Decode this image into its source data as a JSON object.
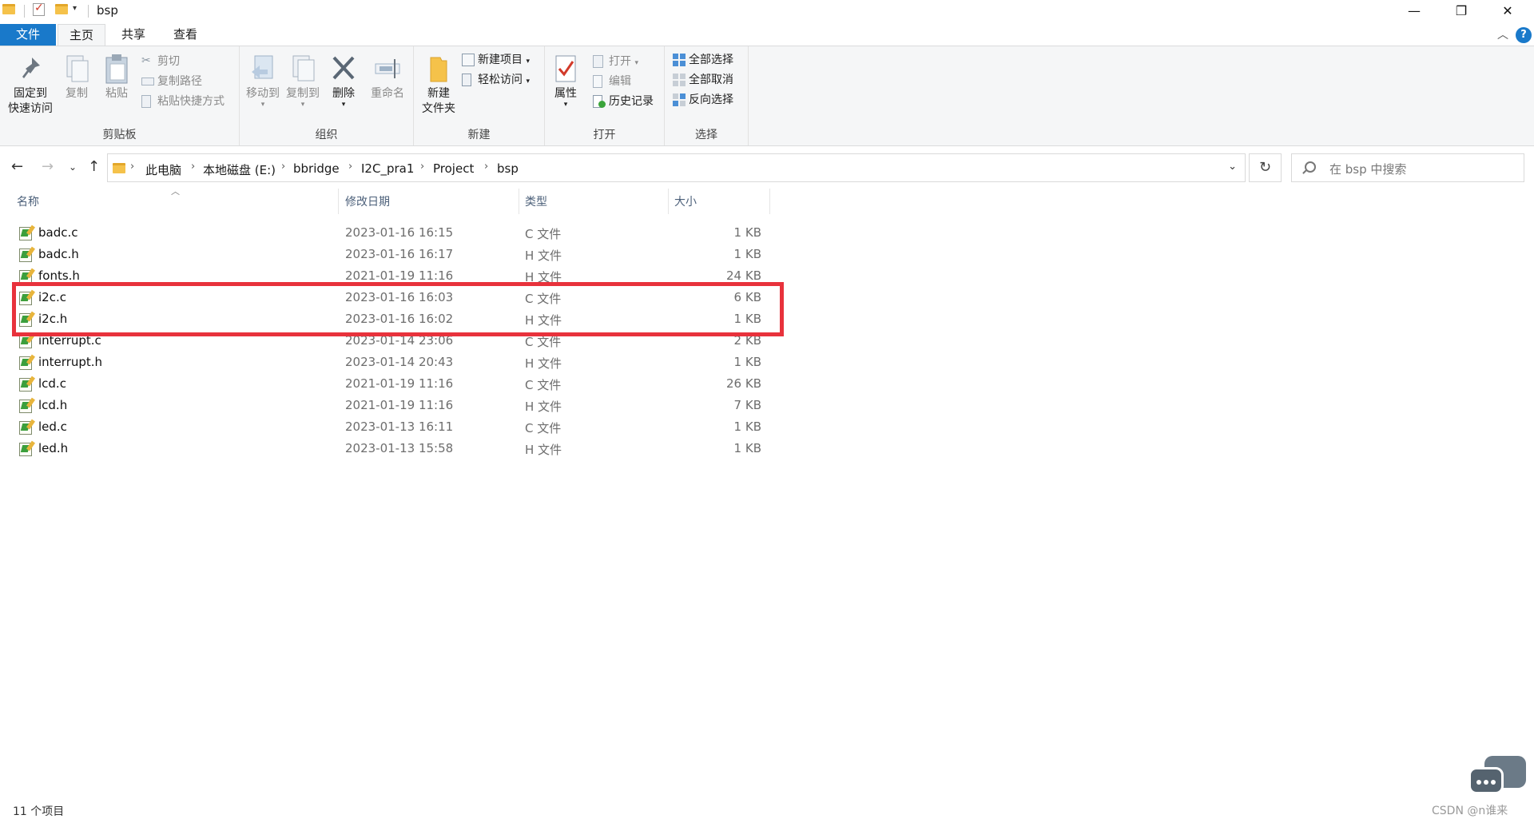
{
  "window": {
    "title": "bsp",
    "quick_access_dropdown": "▾",
    "minimize": "—",
    "maximize": "❐",
    "close": "✕"
  },
  "tabs": [
    {
      "label": "文件"
    },
    {
      "label": "主页"
    },
    {
      "label": "共享"
    },
    {
      "label": "查看"
    }
  ],
  "ribbon": {
    "clipboard": {
      "label": "剪贴板",
      "pin_line1": "固定到",
      "pin_line2": "快速访问",
      "copy": "复制",
      "paste": "粘贴",
      "cut": "剪切",
      "copy_path": "复制路径",
      "paste_shortcut": "粘贴快捷方式"
    },
    "organize": {
      "label": "组织",
      "move_to": "移动到",
      "copy_to": "复制到",
      "delete": "删除",
      "rename": "重命名"
    },
    "new": {
      "label": "新建",
      "new_folder_line1": "新建",
      "new_folder_line2": "文件夹",
      "new_item": "新建项目",
      "easy_access": "轻松访问"
    },
    "open": {
      "label": "打开",
      "properties": "属性",
      "open": "打开",
      "edit": "编辑",
      "history": "历史记录"
    },
    "select": {
      "label": "选择",
      "select_all": "全部选择",
      "select_none": "全部取消",
      "invert": "反向选择"
    }
  },
  "breadcrumb": [
    "此电脑",
    "本地磁盘 (E:)",
    "bbridge",
    "I2C_pra1",
    "Project",
    "bsp"
  ],
  "search": {
    "placeholder": "在 bsp 中搜索"
  },
  "columns": {
    "name": "名称",
    "date": "修改日期",
    "type": "类型",
    "size": "大小"
  },
  "files": [
    {
      "name": "badc.c",
      "date": "2023-01-16 16:15",
      "type": "C 文件",
      "size": "1 KB"
    },
    {
      "name": "badc.h",
      "date": "2023-01-16 16:17",
      "type": "H 文件",
      "size": "1 KB"
    },
    {
      "name": "fonts.h",
      "date": "2021-01-19 11:16",
      "type": "H 文件",
      "size": "24 KB"
    },
    {
      "name": "i2c.c",
      "date": "2023-01-16 16:03",
      "type": "C 文件",
      "size": "6 KB"
    },
    {
      "name": "i2c.h",
      "date": "2023-01-16 16:02",
      "type": "H 文件",
      "size": "1 KB"
    },
    {
      "name": "interrupt.c",
      "date": "2023-01-14 23:06",
      "type": "C 文件",
      "size": "2 KB"
    },
    {
      "name": "interrupt.h",
      "date": "2023-01-14 20:43",
      "type": "H 文件",
      "size": "1 KB"
    },
    {
      "name": "lcd.c",
      "date": "2021-01-19 11:16",
      "type": "C 文件",
      "size": "26 KB"
    },
    {
      "name": "lcd.h",
      "date": "2021-01-19 11:16",
      "type": "H 文件",
      "size": "7 KB"
    },
    {
      "name": "led.c",
      "date": "2023-01-13 16:11",
      "type": "C 文件",
      "size": "1 KB"
    },
    {
      "name": "led.h",
      "date": "2023-01-13 15:58",
      "type": "H 文件",
      "size": "1 KB"
    }
  ],
  "status": {
    "count": "11 个项目"
  },
  "watermark": "CSDN @n谁来",
  "colors": {
    "accent": "#1979ca",
    "highlight": "#e8323c",
    "ribbon_bg": "#f5f6f7"
  }
}
